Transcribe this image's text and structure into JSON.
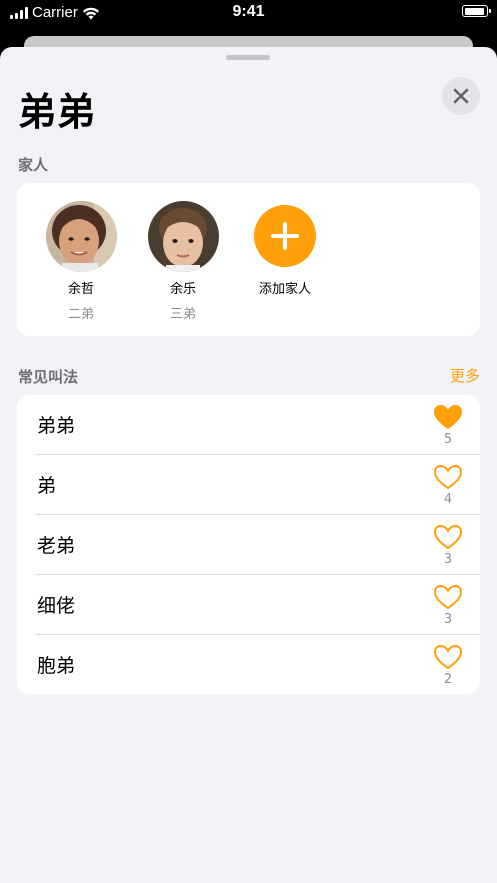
{
  "status_bar": {
    "carrier": "Carrier",
    "time": "9:41"
  },
  "sheet": {
    "title": "弟弟"
  },
  "family": {
    "section_label": "家人",
    "members": [
      {
        "name": "余哲",
        "relation": "二弟"
      },
      {
        "name": "余乐",
        "relation": "三弟"
      }
    ],
    "add_label": "添加家人"
  },
  "names": {
    "section_label": "常见叫法",
    "more_label": "更多",
    "items": [
      {
        "label": "弟弟",
        "count": "5",
        "liked": true
      },
      {
        "label": "弟",
        "count": "4",
        "liked": false
      },
      {
        "label": "老弟",
        "count": "3",
        "liked": false
      },
      {
        "label": "细佬",
        "count": "3",
        "liked": false
      },
      {
        "label": "胞弟",
        "count": "2",
        "liked": false
      }
    ]
  },
  "colors": {
    "accent": "#ff9f0a",
    "background": "#f2f2f7",
    "card": "#ffffff",
    "secondary_text": "#8e8e93"
  },
  "icons": [
    "wifi-icon",
    "battery-icon",
    "close-icon",
    "plus-icon",
    "heart-filled-icon",
    "heart-outline-icon"
  ]
}
